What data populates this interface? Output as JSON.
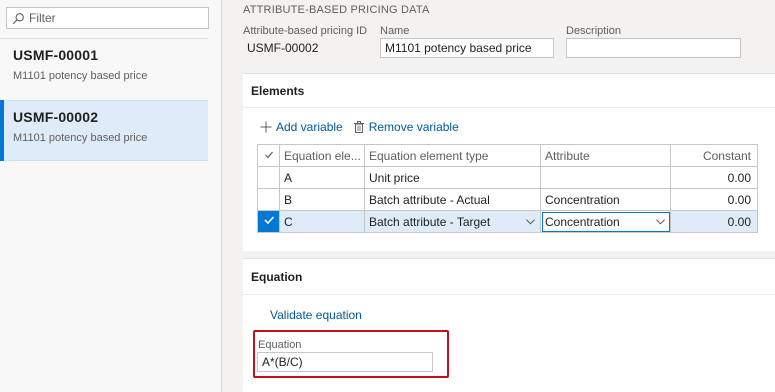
{
  "filter": {
    "placeholder": "Filter"
  },
  "records": [
    {
      "id": "USMF-00001",
      "description": "M1101 potency based price"
    },
    {
      "id": "USMF-00002",
      "description": "M1101 potency based price"
    }
  ],
  "header": {
    "section_title": "ATTRIBUTE-BASED PRICING DATA",
    "id_label": "Attribute-based pricing ID",
    "id_value": "USMF-00002",
    "name_label": "Name",
    "name_value": "M1101 potency based price",
    "description_label": "Description",
    "description_value": ""
  },
  "elements": {
    "title": "Elements",
    "add_label": "Add variable",
    "remove_label": "Remove variable",
    "columns": [
      "Equation ele...",
      "Equation element type",
      "Attribute",
      "Constant"
    ],
    "rows": [
      {
        "element": "A",
        "type": "Unit price",
        "attribute": "",
        "constant": "0.00"
      },
      {
        "element": "B",
        "type": "Batch attribute - Actual",
        "attribute": "Concentration",
        "constant": "0.00"
      },
      {
        "element": "C",
        "type": "Batch attribute - Target",
        "attribute": "Concentration",
        "constant": "0.00"
      }
    ]
  },
  "equation": {
    "title": "Equation",
    "validate_label": "Validate equation",
    "field_label": "Equation",
    "value": "A*(B/C)"
  },
  "colors": {
    "accent": "#0078d4",
    "link": "#005a9e",
    "highlight_border": "#c50f1f",
    "selected_row": "#deecf9"
  }
}
